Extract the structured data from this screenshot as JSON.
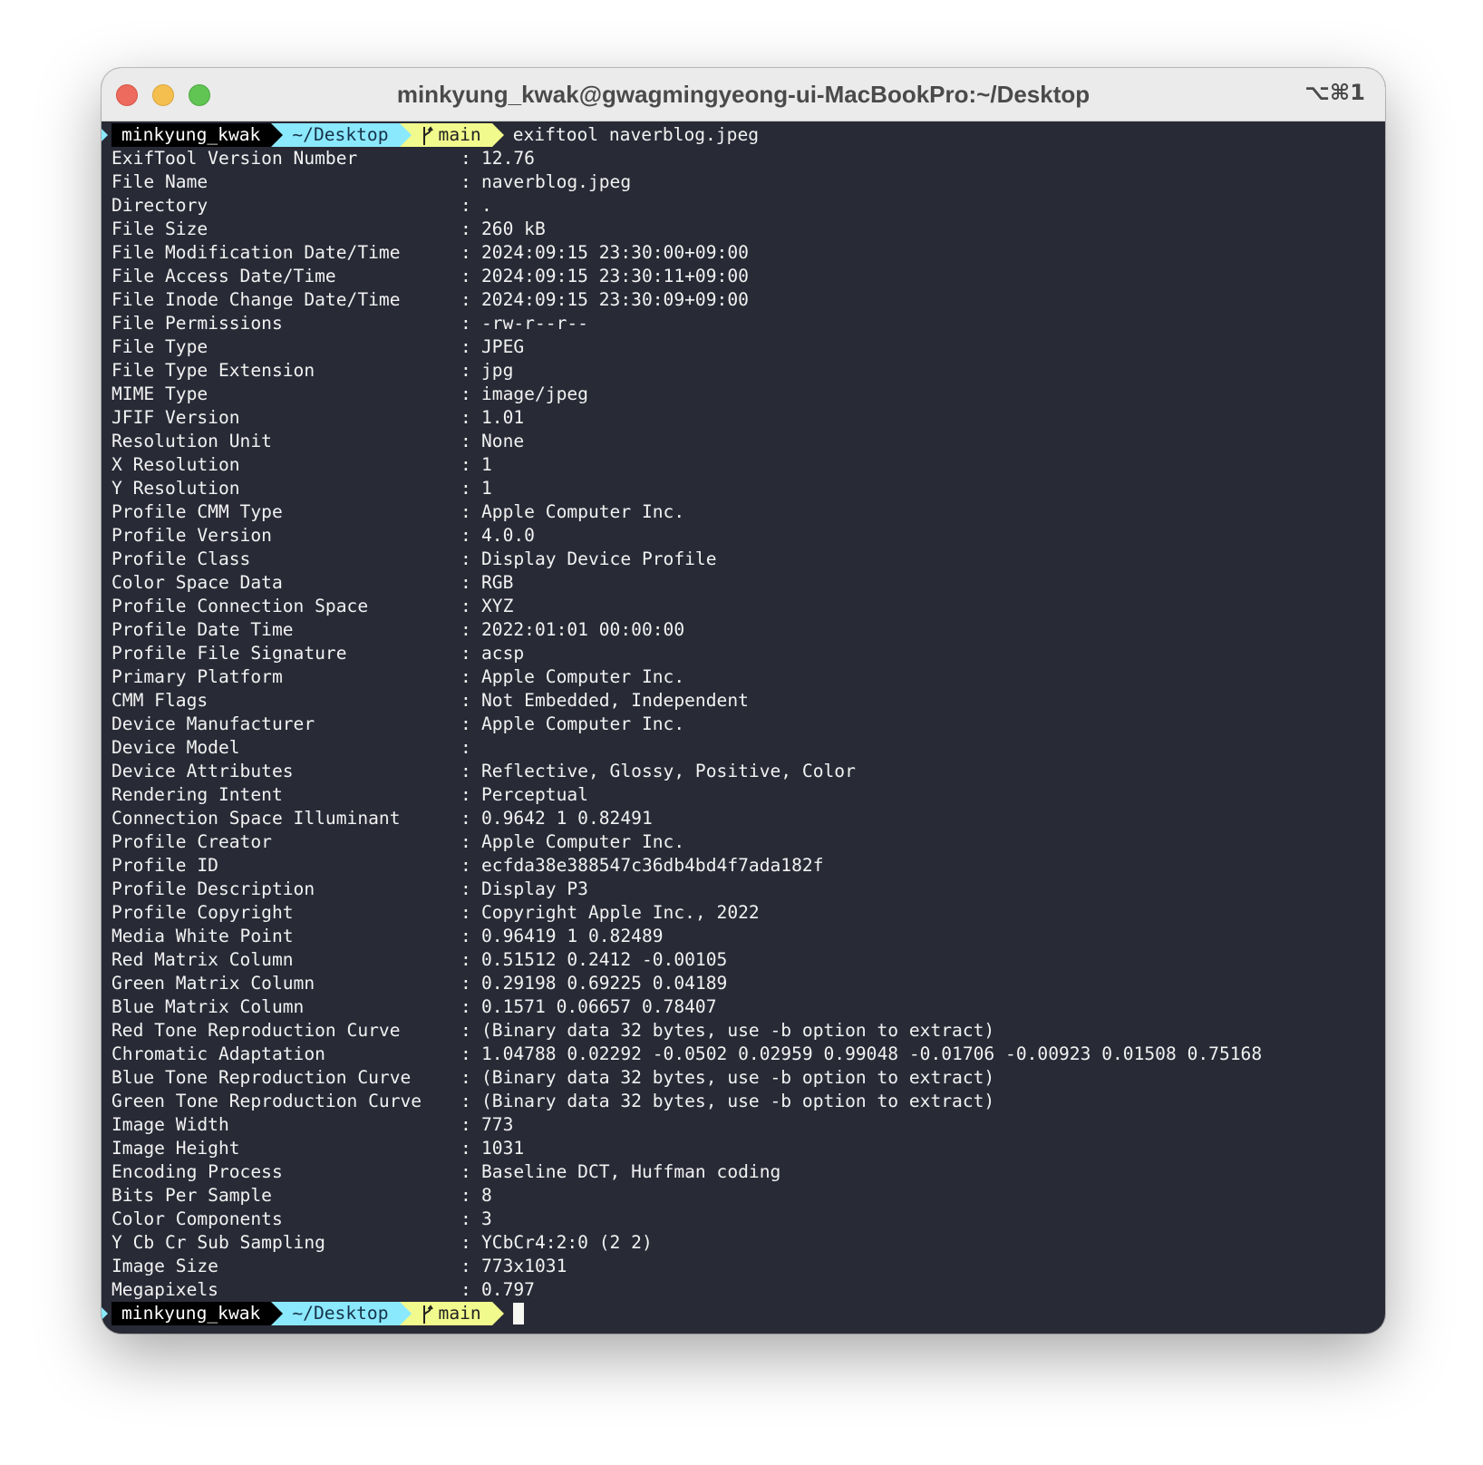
{
  "window": {
    "title": "minkyung_kwak@gwagmingyeong-ui-MacBookPro:~/Desktop",
    "shortcut": "⌥⌘1"
  },
  "colors": {
    "terminal_bg": "#282a36",
    "prompt_user_bg": "#000000",
    "prompt_dir_bg": "#8be9fd",
    "prompt_git_bg": "#f1fa8c",
    "text": "#f2f2f2"
  },
  "prompt": {
    "user": "minkyung_kwak",
    "dir": "~/Desktop",
    "branch": "main",
    "branch_icon": "git-branch-icon"
  },
  "command": "exiftool naverblog.jpeg",
  "rows": [
    {
      "key": "ExifTool Version Number",
      "value": "12.76"
    },
    {
      "key": "File Name",
      "value": "naverblog.jpeg"
    },
    {
      "key": "Directory",
      "value": "."
    },
    {
      "key": "File Size",
      "value": "260 kB"
    },
    {
      "key": "File Modification Date/Time",
      "value": "2024:09:15 23:30:00+09:00"
    },
    {
      "key": "File Access Date/Time",
      "value": "2024:09:15 23:30:11+09:00"
    },
    {
      "key": "File Inode Change Date/Time",
      "value": "2024:09:15 23:30:09+09:00"
    },
    {
      "key": "File Permissions",
      "value": "-rw-r--r--"
    },
    {
      "key": "File Type",
      "value": "JPEG"
    },
    {
      "key": "File Type Extension",
      "value": "jpg"
    },
    {
      "key": "MIME Type",
      "value": "image/jpeg"
    },
    {
      "key": "JFIF Version",
      "value": "1.01"
    },
    {
      "key": "Resolution Unit",
      "value": "None"
    },
    {
      "key": "X Resolution",
      "value": "1"
    },
    {
      "key": "Y Resolution",
      "value": "1"
    },
    {
      "key": "Profile CMM Type",
      "value": "Apple Computer Inc."
    },
    {
      "key": "Profile Version",
      "value": "4.0.0"
    },
    {
      "key": "Profile Class",
      "value": "Display Device Profile"
    },
    {
      "key": "Color Space Data",
      "value": "RGB"
    },
    {
      "key": "Profile Connection Space",
      "value": "XYZ"
    },
    {
      "key": "Profile Date Time",
      "value": "2022:01:01 00:00:00"
    },
    {
      "key": "Profile File Signature",
      "value": "acsp"
    },
    {
      "key": "Primary Platform",
      "value": "Apple Computer Inc."
    },
    {
      "key": "CMM Flags",
      "value": "Not Embedded, Independent"
    },
    {
      "key": "Device Manufacturer",
      "value": "Apple Computer Inc."
    },
    {
      "key": "Device Model",
      "value": ""
    },
    {
      "key": "Device Attributes",
      "value": "Reflective, Glossy, Positive, Color"
    },
    {
      "key": "Rendering Intent",
      "value": "Perceptual"
    },
    {
      "key": "Connection Space Illuminant",
      "value": "0.9642 1 0.82491"
    },
    {
      "key": "Profile Creator",
      "value": "Apple Computer Inc."
    },
    {
      "key": "Profile ID",
      "value": "ecfda38e388547c36db4bd4f7ada182f"
    },
    {
      "key": "Profile Description",
      "value": "Display P3"
    },
    {
      "key": "Profile Copyright",
      "value": "Copyright Apple Inc., 2022"
    },
    {
      "key": "Media White Point",
      "value": "0.96419 1 0.82489"
    },
    {
      "key": "Red Matrix Column",
      "value": "0.51512 0.2412 -0.00105"
    },
    {
      "key": "Green Matrix Column",
      "value": "0.29198 0.69225 0.04189"
    },
    {
      "key": "Blue Matrix Column",
      "value": "0.1571 0.06657 0.78407"
    },
    {
      "key": "Red Tone Reproduction Curve",
      "value": "(Binary data 32 bytes, use -b option to extract)"
    },
    {
      "key": "Chromatic Adaptation",
      "value": "1.04788 0.02292 -0.0502 0.02959 0.99048 -0.01706 -0.00923 0.01508 0.75168"
    },
    {
      "key": "Blue Tone Reproduction Curve",
      "value": "(Binary data 32 bytes, use -b option to extract)"
    },
    {
      "key": "Green Tone Reproduction Curve",
      "value": "(Binary data 32 bytes, use -b option to extract)"
    },
    {
      "key": "Image Width",
      "value": "773"
    },
    {
      "key": "Image Height",
      "value": "1031"
    },
    {
      "key": "Encoding Process",
      "value": "Baseline DCT, Huffman coding"
    },
    {
      "key": "Bits Per Sample",
      "value": "8"
    },
    {
      "key": "Color Components",
      "value": "3"
    },
    {
      "key": "Y Cb Cr Sub Sampling",
      "value": "YCbCr4:2:0 (2 2)"
    },
    {
      "key": "Image Size",
      "value": "773x1031"
    },
    {
      "key": "Megapixels",
      "value": "0.797"
    }
  ]
}
